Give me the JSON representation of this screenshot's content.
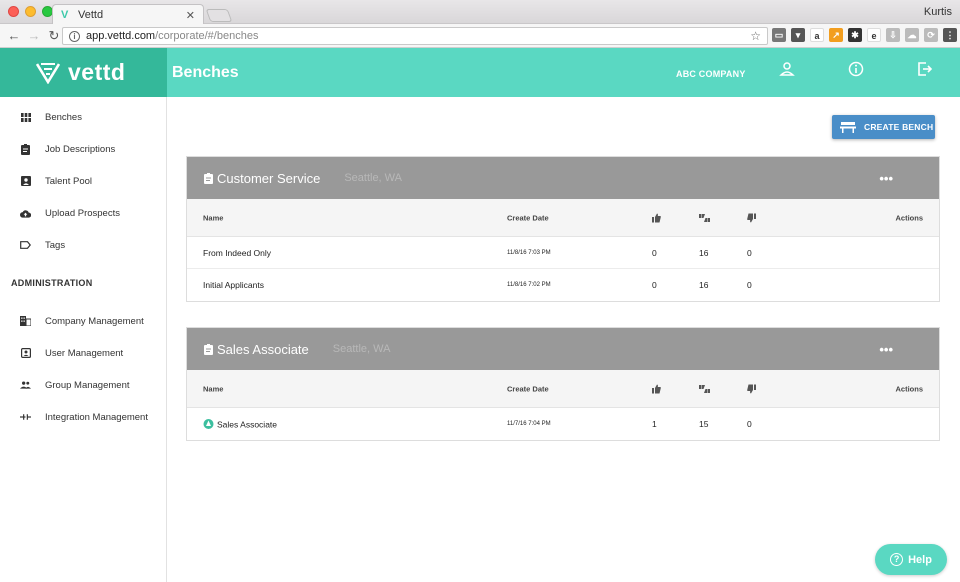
{
  "browser": {
    "tab_title": "Vettd",
    "user": "Kurtis",
    "url_host": "app.vettd.com",
    "url_path": "/corporate/#/benches",
    "extensions": [
      {
        "name": "cast-icon",
        "color": "#777777",
        "label": "▭"
      },
      {
        "name": "pocket-icon",
        "color": "#555555",
        "label": "▾"
      },
      {
        "name": "amazon-icon",
        "color": "#ffffff",
        "label": "a"
      },
      {
        "name": "graph-icon",
        "color": "#f29e1f",
        "label": "↗"
      },
      {
        "name": "gear-icon",
        "color": "#333333",
        "label": "✱"
      },
      {
        "name": "ebay-icon",
        "color": "#ffffff",
        "label": "e"
      },
      {
        "name": "download-icon",
        "color": "#bbbbbb",
        "label": "⇩"
      },
      {
        "name": "cloud-icon",
        "color": "#bbbbbb",
        "label": "☁"
      },
      {
        "name": "sync-icon",
        "color": "#bbbbbb",
        "label": "⟳"
      },
      {
        "name": "menu-icon",
        "color": "#555555",
        "label": "⋮"
      }
    ]
  },
  "header": {
    "logo": "vettd",
    "title": "Benches",
    "company": "ABC COMPANY"
  },
  "sidebar": {
    "items": [
      {
        "label": "Benches"
      },
      {
        "label": "Job Descriptions"
      },
      {
        "label": "Talent Pool"
      },
      {
        "label": "Upload Prospects"
      },
      {
        "label": "Tags"
      }
    ],
    "admin_label": "ADMINISTRATION",
    "admin_items": [
      {
        "label": "Company Management"
      },
      {
        "label": "User Management"
      },
      {
        "label": "Group Management"
      },
      {
        "label": "Integration Management"
      }
    ]
  },
  "main": {
    "create_label": "CREATE BENCH",
    "columns": {
      "name": "Name",
      "date": "Create Date",
      "actions": "Actions"
    },
    "benches": [
      {
        "title": "Customer Service",
        "location": "Seattle, WA",
        "menu": "•••",
        "rows": [
          {
            "name": "From Indeed Only",
            "date": "11/8/16 7:03 PM",
            "up": "0",
            "flip": "16",
            "down": "0"
          },
          {
            "name": "Initial Applicants",
            "date": "11/8/16 7:02 PM",
            "up": "0",
            "flip": "16",
            "down": "0"
          }
        ]
      },
      {
        "title": "Sales Associate",
        "location": "Seattle, WA",
        "menu": "•••",
        "rows": [
          {
            "name": "Sales Associate",
            "date": "11/7/16 7:04 PM",
            "up": "1",
            "flip": "15",
            "down": "0"
          }
        ]
      }
    ]
  },
  "help": {
    "label": "Help",
    "q": "?"
  }
}
